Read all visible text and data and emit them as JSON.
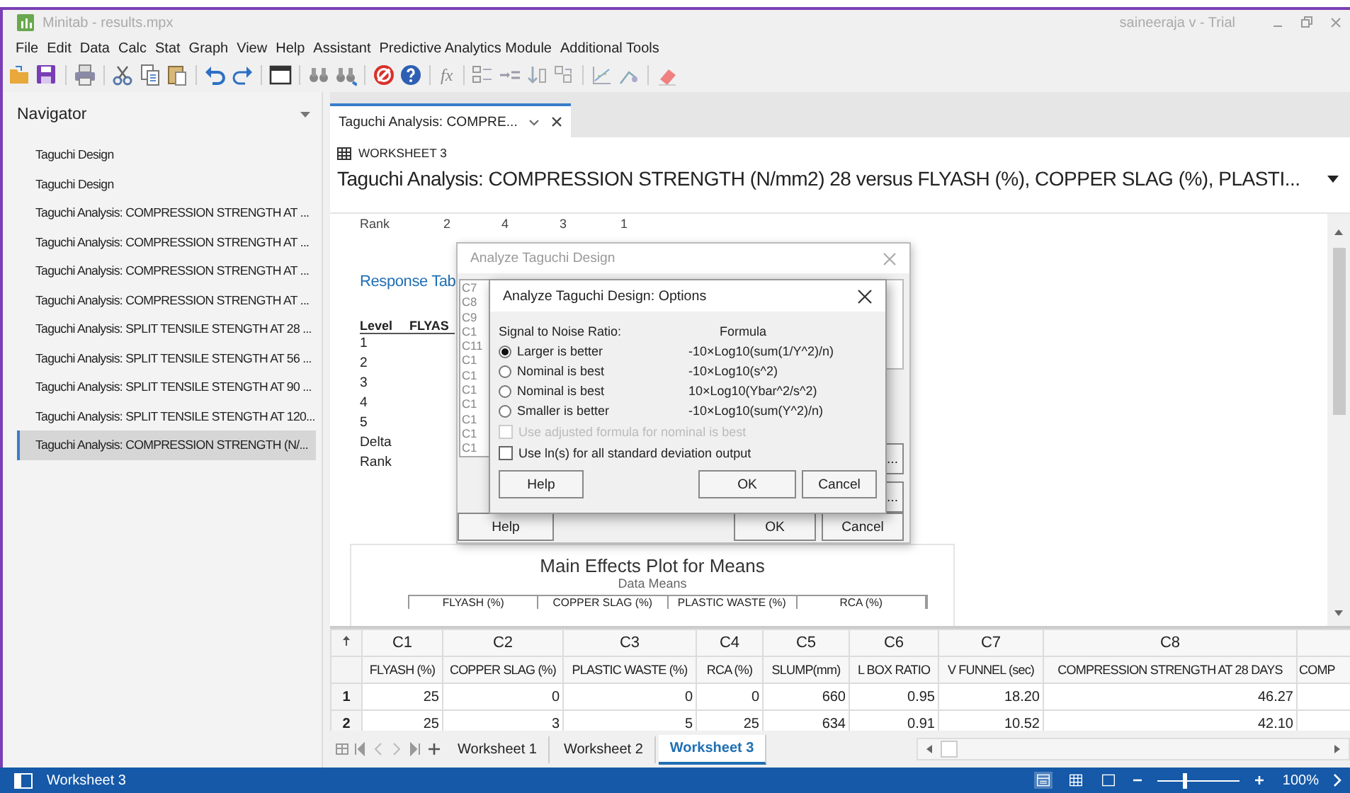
{
  "app": {
    "title": "Minitab - results.mpx",
    "user": "saineeraja v - Trial"
  },
  "menu": [
    "File",
    "Edit",
    "Data",
    "Calc",
    "Stat",
    "Graph",
    "View",
    "Help",
    "Assistant",
    "Predictive Analytics Module",
    "Additional Tools"
  ],
  "toolbar": {
    "function_label": "fx"
  },
  "navigator": {
    "title": "Navigator",
    "items": [
      {
        "label": "Taguchi Design",
        "selected": false
      },
      {
        "label": "Taguchi Design",
        "selected": false
      },
      {
        "label": "Taguchi Analysis: COMPRESSION STRENGTH AT ...",
        "selected": false
      },
      {
        "label": "Taguchi Analysis: COMPRESSION STRENGTH AT ...",
        "selected": false
      },
      {
        "label": "Taguchi Analysis: COMPRESSION STRENGTH AT ...",
        "selected": false
      },
      {
        "label": "Taguchi Analysis: COMPRESSION STRENGTH AT ...",
        "selected": false
      },
      {
        "label": "Taguchi Analysis: SPLIT TENSILE STENGTH AT 28 ...",
        "selected": false
      },
      {
        "label": "Taguchi Analysis: SPLIT TENSILE STENGTH AT 56 ...",
        "selected": false
      },
      {
        "label": "Taguchi Analysis: SPLIT TENSILE STENGTH AT 90 ...",
        "selected": false
      },
      {
        "label": "Taguchi Analysis: SPLIT TENSILE STENGTH AT 120...",
        "selected": false
      },
      {
        "label": "Taguchi Analysis: COMPRESSION STRENGTH (N/...",
        "selected": true
      }
    ]
  },
  "tabs": [
    {
      "label": "Taguchi Analysis: COMPRE...",
      "selected": true
    }
  ],
  "output": {
    "worksheet": "WORKSHEET 3",
    "title": "Taguchi Analysis: COMPRESSION STRENGTH (N/mm2) 28 versus FLYASH (%), COPPER SLAG (%), PLASTI...",
    "rank_row": [
      "Rank",
      "2",
      "4",
      "3",
      "1"
    ],
    "response_heading": "Response Tab",
    "level_header": [
      "Level",
      "FLYAS"
    ],
    "level_rows": [
      "1",
      "2",
      "3",
      "4",
      "5",
      "Delta",
      "Rank"
    ],
    "plot": {
      "title": "Main Effects Plot for Means",
      "subtitle": "Data Means",
      "panels": [
        "FLYASH (%)",
        "COPPER SLAG (%)",
        "PLASTIC WASTE (%)",
        "RCA (%)"
      ]
    }
  },
  "dialog": {
    "title": "Analyze Taguchi Design",
    "columns": [
      "C7",
      "C8",
      "C9",
      "C1",
      "C11",
      "C1",
      "C1",
      "C1",
      "C1",
      "C1",
      "C1",
      "C1"
    ],
    "side_buttons": [
      "...",
      "..."
    ],
    "buttons": [
      "Help",
      "OK",
      "Cancel"
    ]
  },
  "options_dialog": {
    "title": "Analyze Taguchi Design: Options",
    "ratio_label": "Signal to Noise Ratio:",
    "formula_label": "Formula",
    "ratios": [
      {
        "label": "Larger is better",
        "formula": "-10×Log10(sum(1/Y^2)/n)",
        "selected": true
      },
      {
        "label": "Nominal is best",
        "formula": "-10×Log10(s^2)",
        "selected": false
      },
      {
        "label": "Nominal is best",
        "formula": "10×Log10(Ybar^2/s^2)",
        "selected": false
      },
      {
        "label": "Smaller is better",
        "formula": "-10×Log10(sum(Y^2)/n)",
        "selected": false
      }
    ],
    "checks": [
      {
        "label": "Use adjusted formula for nominal is best",
        "checked": false,
        "disabled": true
      },
      {
        "label": "Use ln(s) for all standard deviation output",
        "checked": false,
        "disabled": false
      }
    ],
    "buttons": [
      "Help",
      "OK",
      "Cancel"
    ]
  },
  "worksheet": {
    "columns": [
      {
        "id": "C1",
        "name": "FLYASH (%)"
      },
      {
        "id": "C2",
        "name": "COPPER SLAG (%)"
      },
      {
        "id": "C3",
        "name": "PLASTIC WASTE (%)"
      },
      {
        "id": "C4",
        "name": "RCA (%)"
      },
      {
        "id": "C5",
        "name": "SLUMP(mm)"
      },
      {
        "id": "C6",
        "name": "L BOX RATIO"
      },
      {
        "id": "C7",
        "name": "V FUNNEL (sec)"
      },
      {
        "id": "C8",
        "name": "COMPRESSION STRENGTH AT 28 DAYS"
      },
      {
        "name": "COMP"
      }
    ],
    "rows": [
      {
        "number": "1",
        "cells": [
          "25",
          "0",
          "0",
          "0",
          "660",
          "0.95",
          "18.20",
          "46.27"
        ]
      },
      {
        "number": "2",
        "cells": [
          "25",
          "3",
          "5",
          "25",
          "634",
          "0.91",
          "10.52",
          "42.10"
        ]
      }
    ]
  },
  "sheet_tabs": [
    {
      "label": "Worksheet 1",
      "selected": false
    },
    {
      "label": "Worksheet 2",
      "selected": false
    },
    {
      "label": "Worksheet 3",
      "selected": true
    }
  ],
  "status_bar": {
    "sheet": "Worksheet 3",
    "zoom": "100%",
    "level": 0.3
  }
}
